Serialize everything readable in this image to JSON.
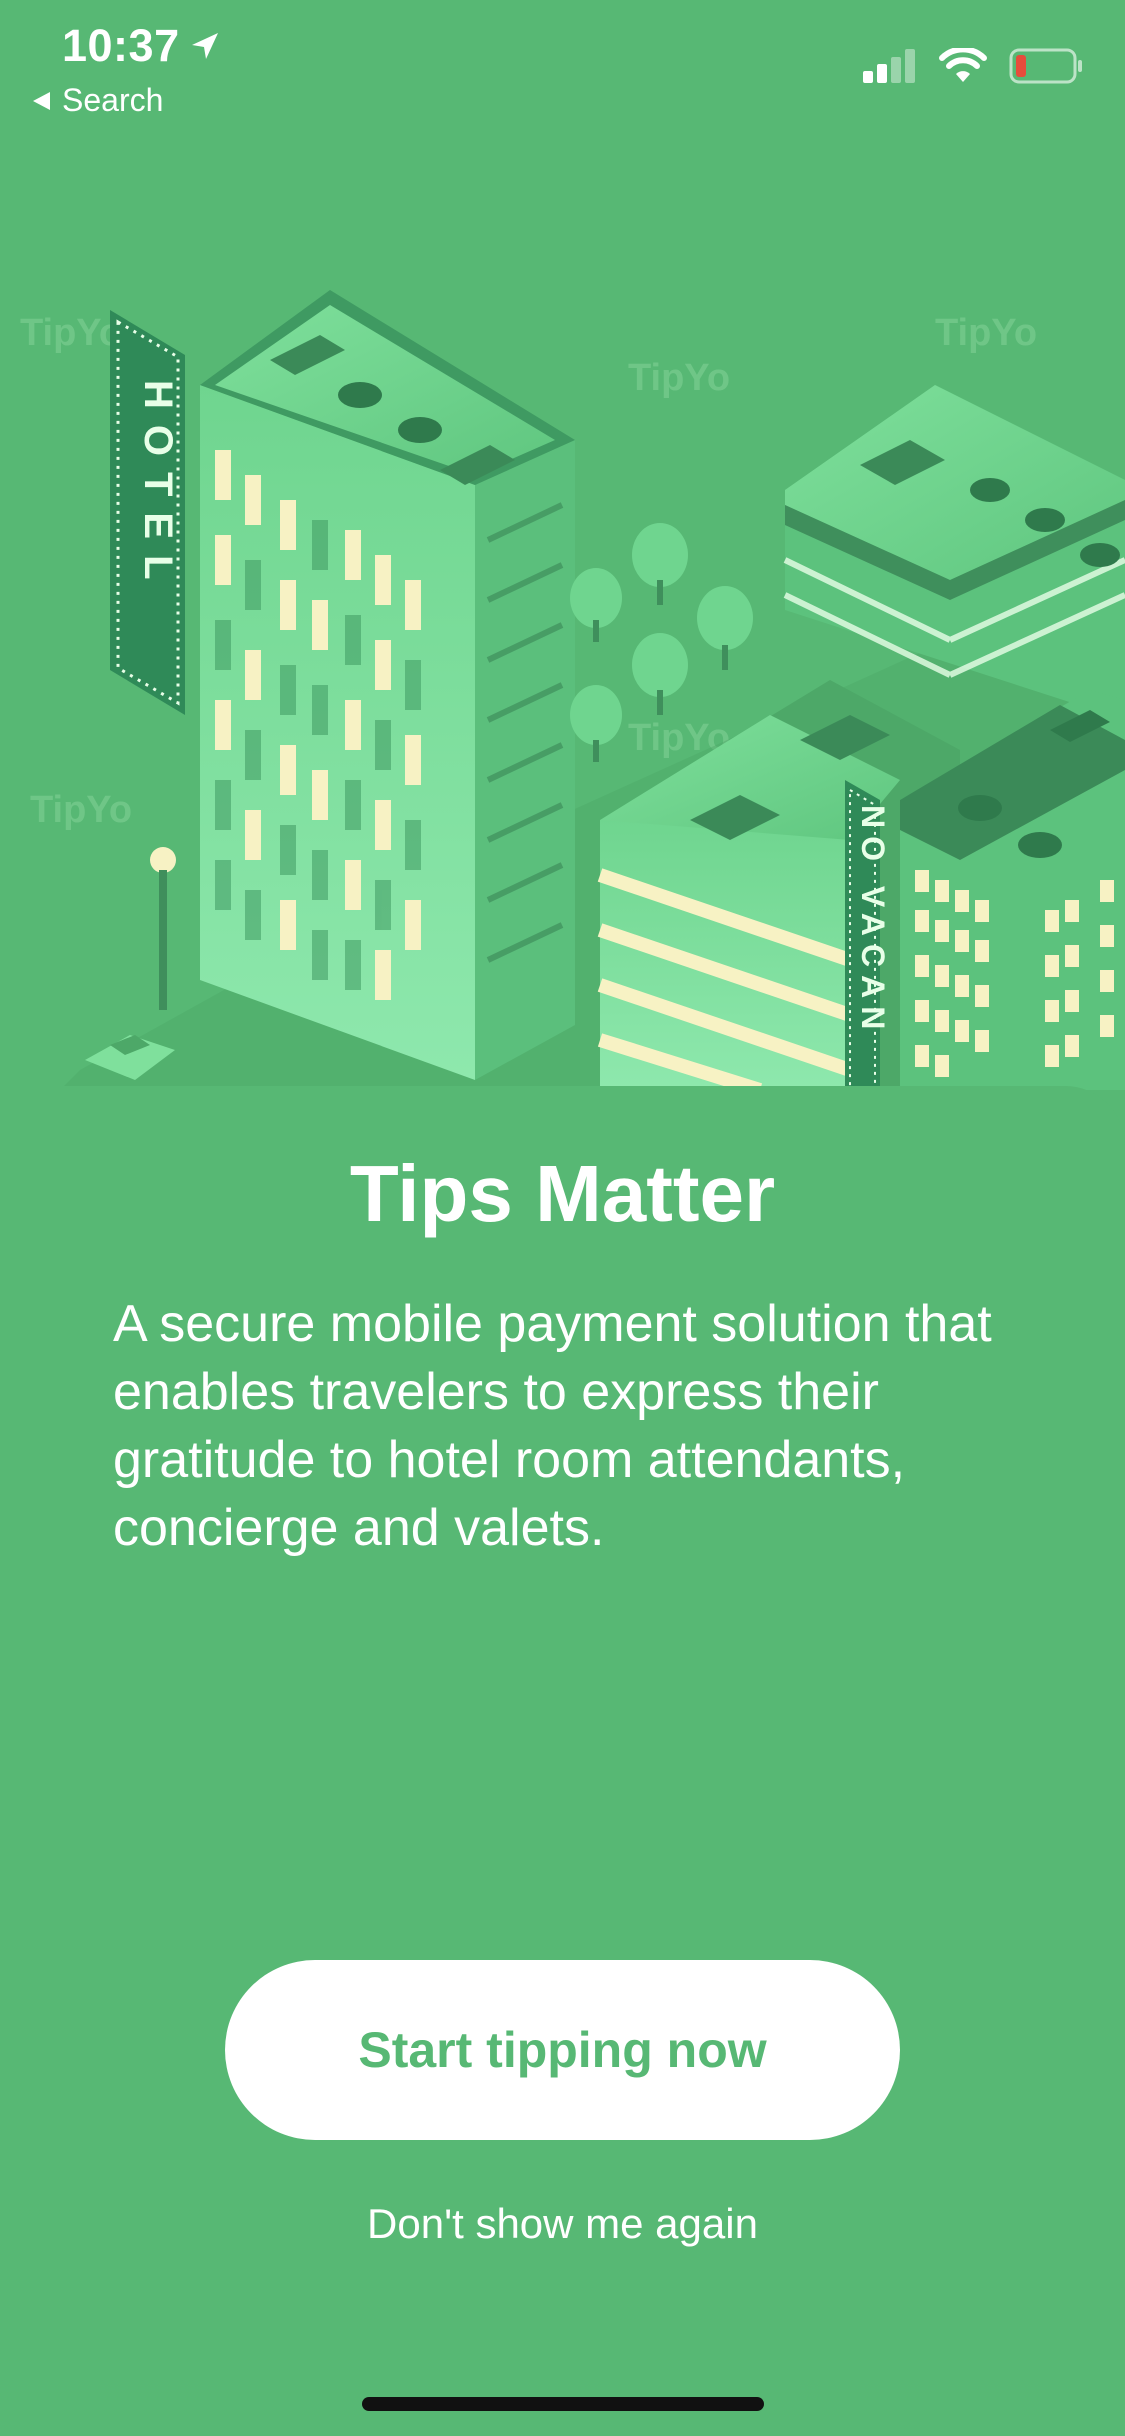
{
  "status_bar": {
    "time": "10:37",
    "back_label": "Search"
  },
  "hero": {
    "hotel_sign": "HOTEL",
    "vacancy_sign": "NO VACAN",
    "watermark": "TipYo"
  },
  "content": {
    "title": "Tips Matter",
    "description": "A secure mobile payment solution that enables travelers to express their gratitude to hotel room attendants, concierge and valets."
  },
  "actions": {
    "primary_label": "Start tipping now",
    "secondary_label": "Don't show me again"
  },
  "colors": {
    "background": "#57b874",
    "button_text": "#57b874",
    "button_bg": "#ffffff"
  }
}
